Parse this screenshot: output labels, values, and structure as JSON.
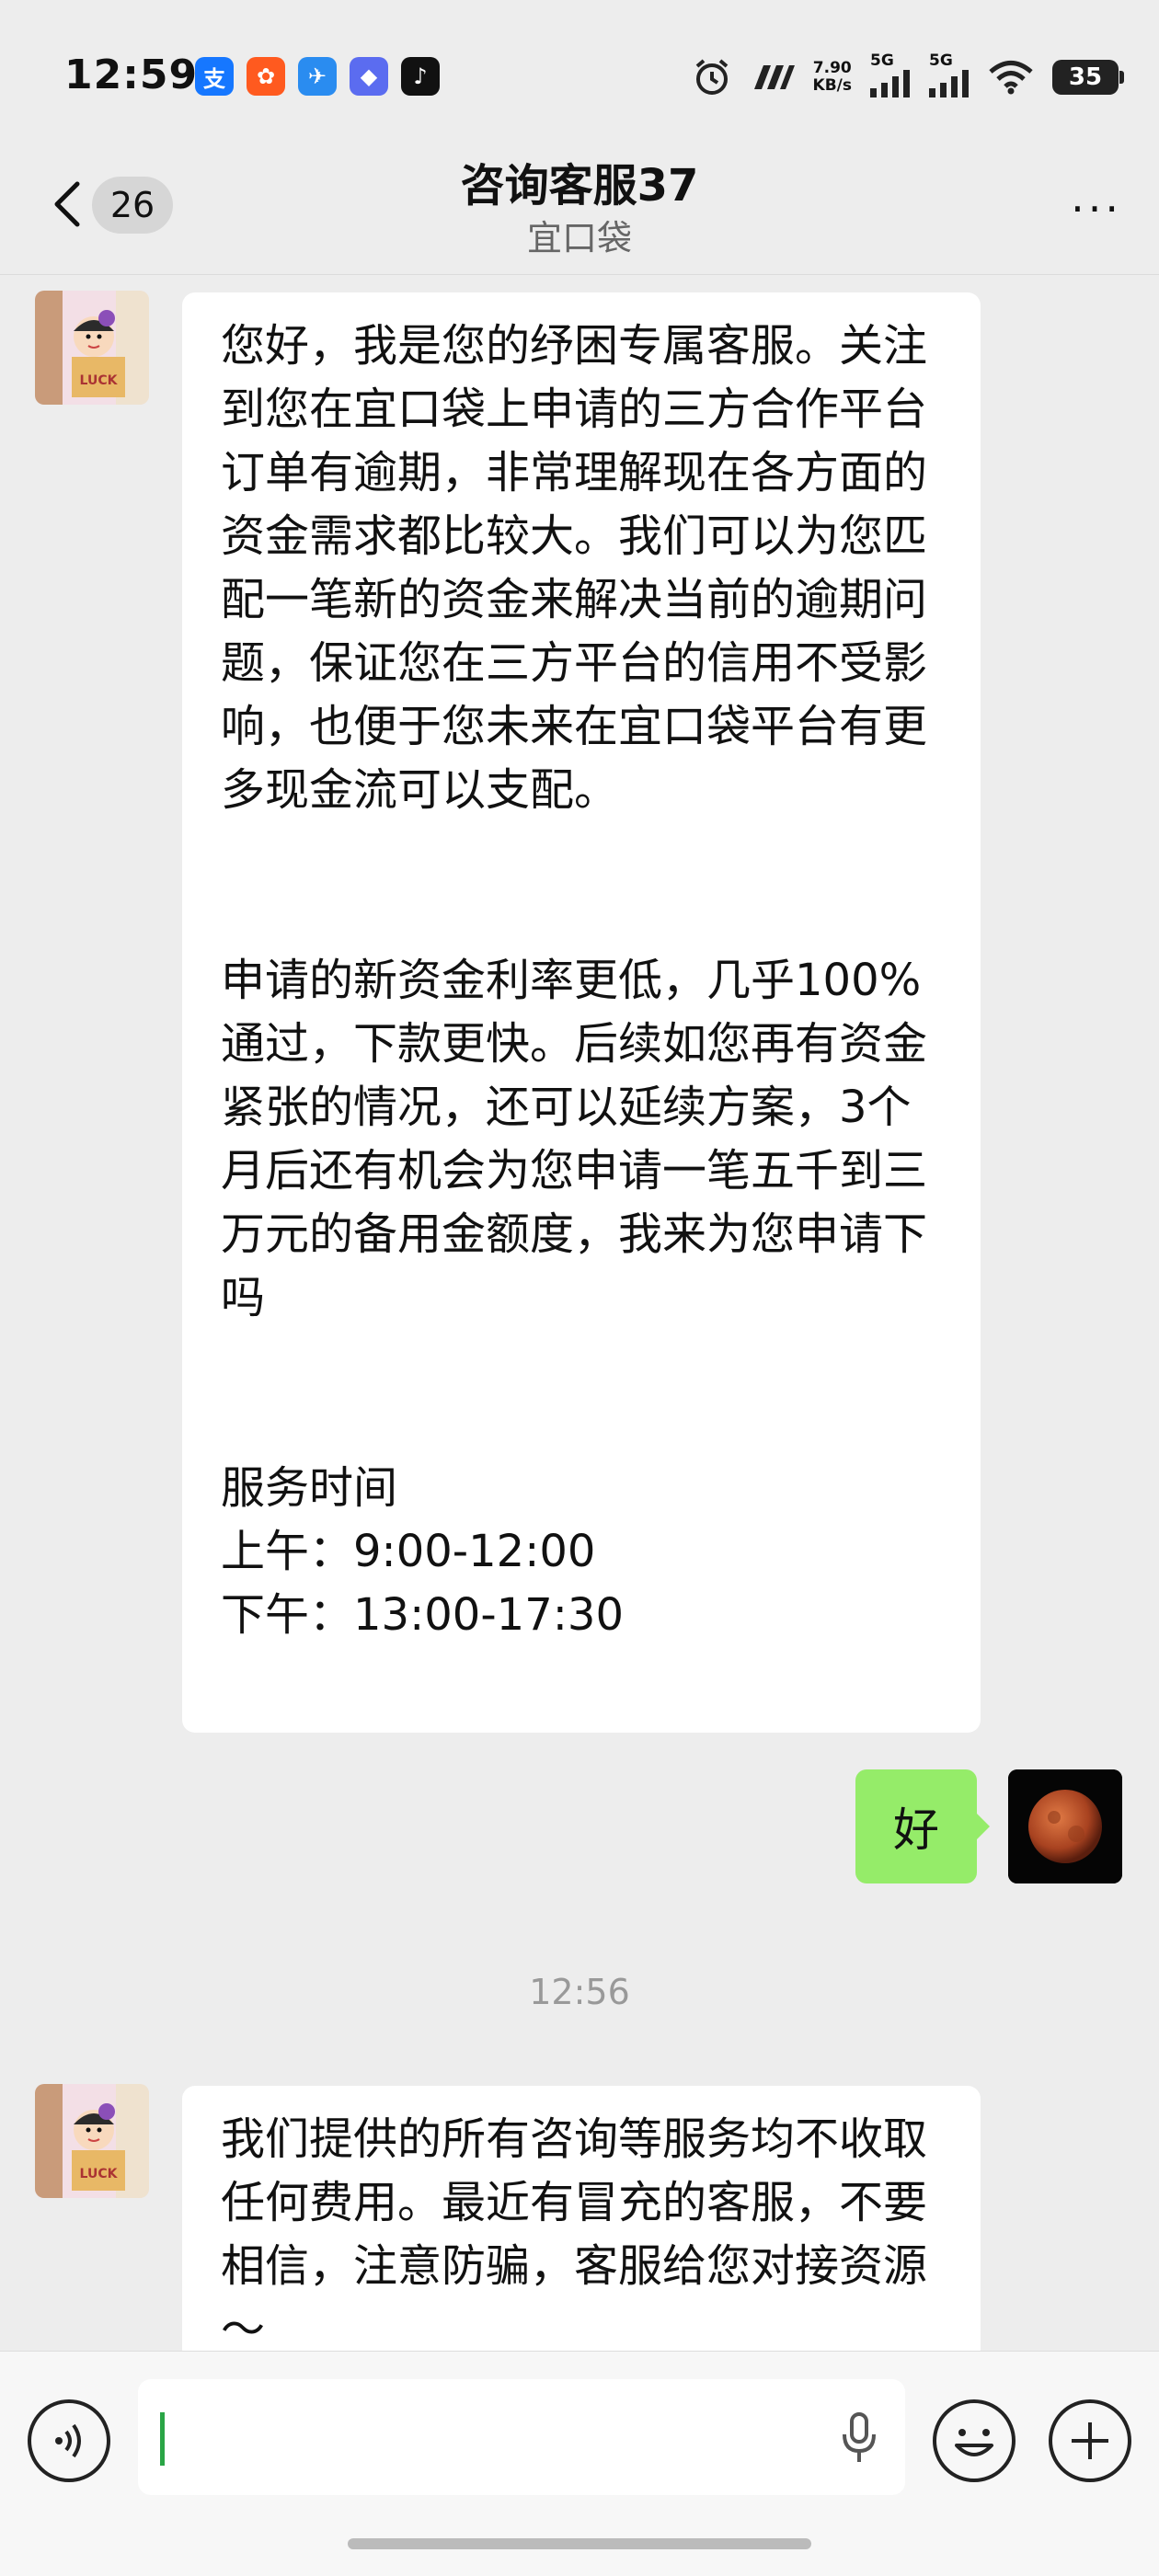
{
  "status": {
    "time": "12:59",
    "net_speed_value": "7.90",
    "net_speed_unit": "KB/s",
    "sig1": "5G",
    "sig2": "5G",
    "battery": "35",
    "apps": [
      {
        "name": "alipay-icon",
        "glyph": "支",
        "color": "#1677ff"
      },
      {
        "name": "app-orange-icon",
        "glyph": "✿",
        "color": "#ff5a1f"
      },
      {
        "name": "app-blue-icon",
        "glyph": "✈",
        "color": "#2a8cf0"
      },
      {
        "name": "app-purple-icon",
        "glyph": "◆",
        "color": "#5b6cf0"
      },
      {
        "name": "tiktok-icon",
        "glyph": "♪",
        "color": "#111111"
      }
    ]
  },
  "header": {
    "unread_count": "26",
    "title": "咨询客服37",
    "subtitle": "宜口袋",
    "more": "···"
  },
  "messages": {
    "m1_p1": "您好，我是您的纾困专属客服。关注到您在宜口袋上申请的三方合作平台订单有逾期，非常理解现在各方面的资金需求都比较大。我们可以为您匹配一笔新的资金来解决当前的逾期问题，保证您在三方平台的信用不受影响，也便于您未来在宜口袋平台有更多现金流可以支配。",
    "m1_p2": "申请的新资金利率更低，几乎100%通过，下款更快。后续如您再有资金紧张的情况，还可以延续方案，3个月后还有机会为您申请一笔五千到三万元的备用金额度，我来为您申请下吗",
    "m1_p3_title": "服务时间",
    "m1_p3_am": "上午：9:00-12:00",
    "m1_p3_pm": "下午：13:00-17:30",
    "reply": "好",
    "timestamp": "12:56",
    "m2": "我们提供的所有咨询等服务均不收取任何费用。最近有冒充的客服，不要相信，注意防骗，客服给您对接资源～"
  },
  "avatar_label": "LUCK"
}
